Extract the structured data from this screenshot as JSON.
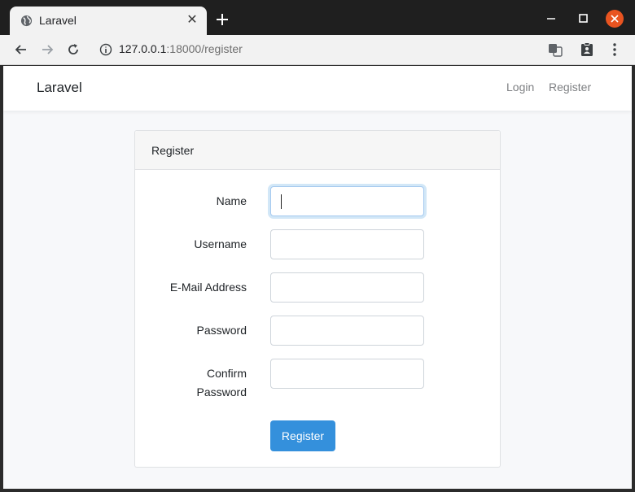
{
  "browser": {
    "tab_title": "Laravel",
    "url_host": "127.0.0.1",
    "url_path": ":18000/register"
  },
  "navbar": {
    "brand": "Laravel",
    "links": [
      "Login",
      "Register"
    ]
  },
  "form": {
    "header": "Register",
    "fields": [
      {
        "label": "Name",
        "value": ""
      },
      {
        "label": "Username",
        "value": ""
      },
      {
        "label": "E-Mail Address",
        "value": ""
      },
      {
        "label": "Password",
        "value": ""
      },
      {
        "label": "Confirm Password",
        "value": ""
      }
    ],
    "submit_label": "Register"
  },
  "colors": {
    "primary": "#3490dc",
    "window_close": "#e95420"
  }
}
